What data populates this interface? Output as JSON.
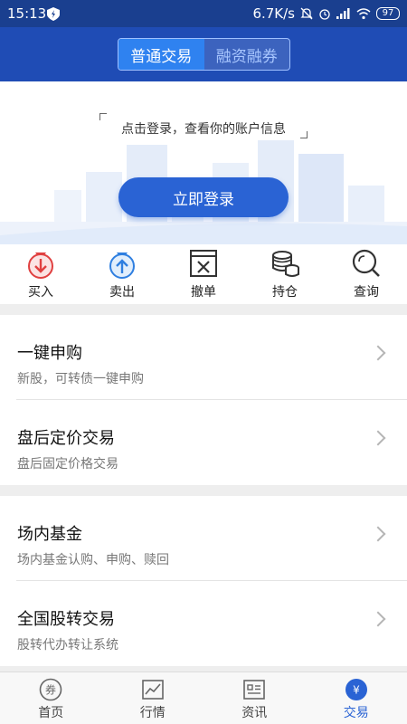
{
  "status_bar": {
    "time": "15:13",
    "speed": "6.7K/s",
    "battery": "97"
  },
  "header": {
    "tabs": [
      {
        "label": "普通交易",
        "active": true
      },
      {
        "label": "融资融券",
        "active": false
      }
    ]
  },
  "login": {
    "prompt": "点击登录，查看你的账户信息",
    "button": "立即登录"
  },
  "quick_actions": [
    {
      "label": "买入",
      "icon": "buy-icon"
    },
    {
      "label": "卖出",
      "icon": "sell-icon"
    },
    {
      "label": "撤单",
      "icon": "cancel-order-icon"
    },
    {
      "label": "持仓",
      "icon": "holdings-icon"
    },
    {
      "label": "查询",
      "icon": "search-icon"
    }
  ],
  "section1": [
    {
      "title": "一键申购",
      "subtitle": "新股，可转债一键申购"
    },
    {
      "title": "盘后定价交易",
      "subtitle": "盘后固定价格交易"
    }
  ],
  "section2": [
    {
      "title": "场内基金",
      "subtitle": "场内基金认购、申购、赎回"
    },
    {
      "title": "全国股转交易",
      "subtitle": "股转代办转让系统"
    }
  ],
  "tabbar": [
    {
      "label": "首页",
      "icon": "home-coupon-icon",
      "active": false
    },
    {
      "label": "行情",
      "icon": "market-chart-icon",
      "active": false
    },
    {
      "label": "资讯",
      "icon": "news-icon",
      "active": false
    },
    {
      "label": "交易",
      "icon": "trade-yen-icon",
      "active": true
    }
  ],
  "colors": {
    "primary": "#1f4cb5",
    "accent": "#2a63d4",
    "buy": "#e04040",
    "sell": "#2f7fe0"
  }
}
